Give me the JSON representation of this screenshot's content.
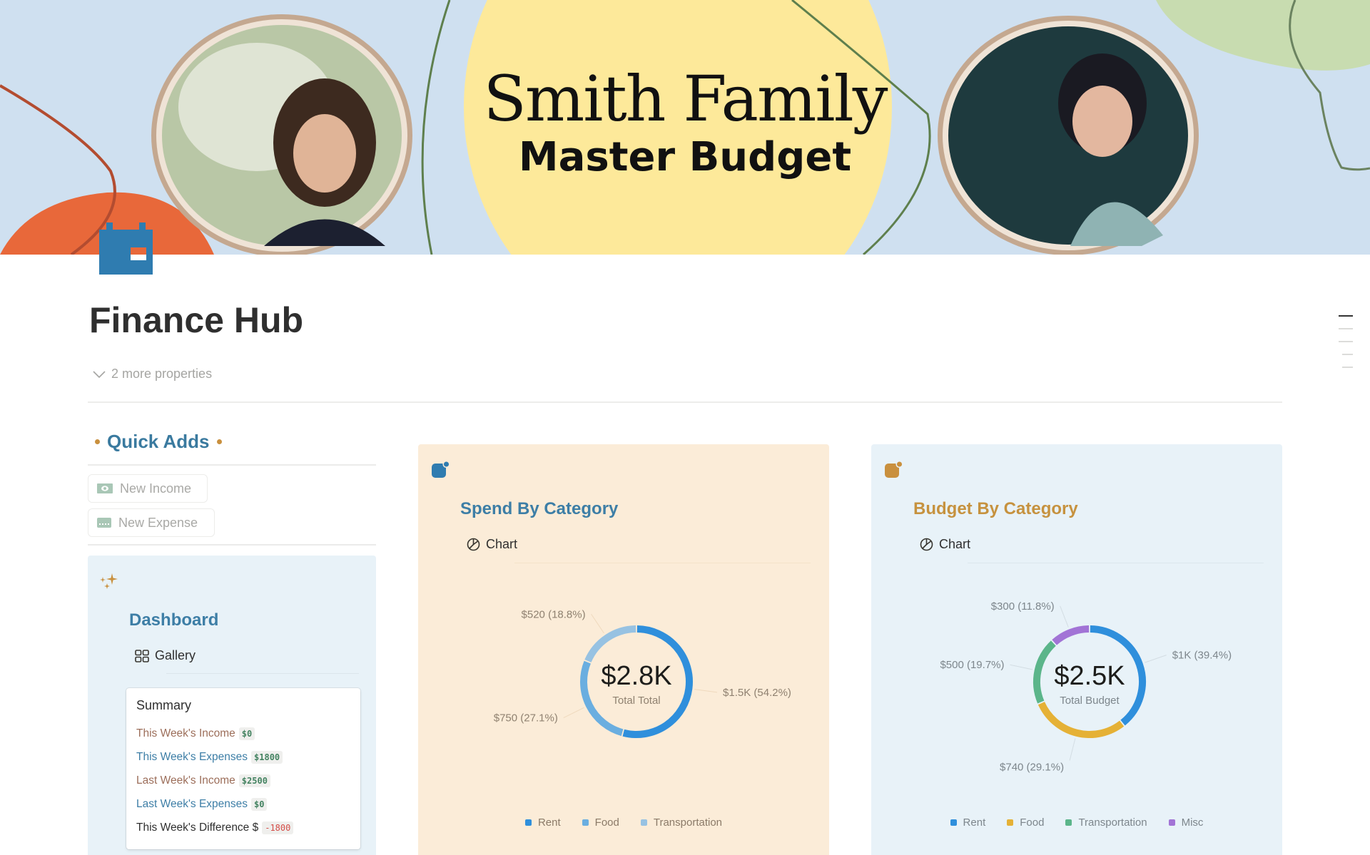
{
  "banner": {
    "title_line1": "Smith Family",
    "title_line2": "Master Budget"
  },
  "page": {
    "icon": "calendar-icon",
    "title": "Finance Hub",
    "more_properties": "2 more properties"
  },
  "quick_adds": {
    "heading": "Quick Adds",
    "buttons": [
      {
        "label": "New Income",
        "icon": "money-icon"
      },
      {
        "label": "New Expense",
        "icon": "credit-card-icon"
      }
    ]
  },
  "dashboard": {
    "title": "Dashboard",
    "view_label": "Gallery",
    "summary": {
      "title": "Summary",
      "rows": [
        {
          "label": "This Week's Income",
          "value": "$0"
        },
        {
          "label": "This Week's Expenses",
          "value": "$1800"
        },
        {
          "label": "Last Week's Income",
          "value": "$2500"
        },
        {
          "label": "Last Week's Expenses",
          "value": "$0"
        },
        {
          "label": "This Week's Difference $",
          "value": "-1800"
        }
      ]
    }
  },
  "spend_card": {
    "title": "Spend By Category",
    "view_label": "Chart"
  },
  "budget_card": {
    "title": "Budget By Category",
    "view_label": "Chart"
  },
  "chart_data": [
    {
      "type": "pie",
      "title": "Spend By Category",
      "center_value": "$2.8K",
      "center_label": "Total Total",
      "categories": [
        "Rent",
        "Food",
        "Transportation"
      ],
      "values": [
        1500,
        750,
        520
      ],
      "labels": [
        "$1.5K (54.2%)",
        "$750 (27.1%)",
        "$520 (18.8%)"
      ],
      "colors": [
        "#2f8fdc",
        "#6aaee0",
        "#97c2e2"
      ],
      "legend": "bottom"
    },
    {
      "type": "pie",
      "title": "Budget By Category",
      "center_value": "$2.5K",
      "center_label": "Total Budget",
      "categories": [
        "Rent",
        "Food",
        "Transportation",
        "Misc"
      ],
      "values": [
        1000,
        740,
        500,
        300
      ],
      "labels": [
        "$1K (39.4%)",
        "$740 (29.1%)",
        "$500 (19.7%)",
        "$300 (11.8%)"
      ],
      "colors": [
        "#2f8fdc",
        "#e5b136",
        "#5bb58a",
        "#a274d6"
      ],
      "legend": "bottom"
    }
  ]
}
